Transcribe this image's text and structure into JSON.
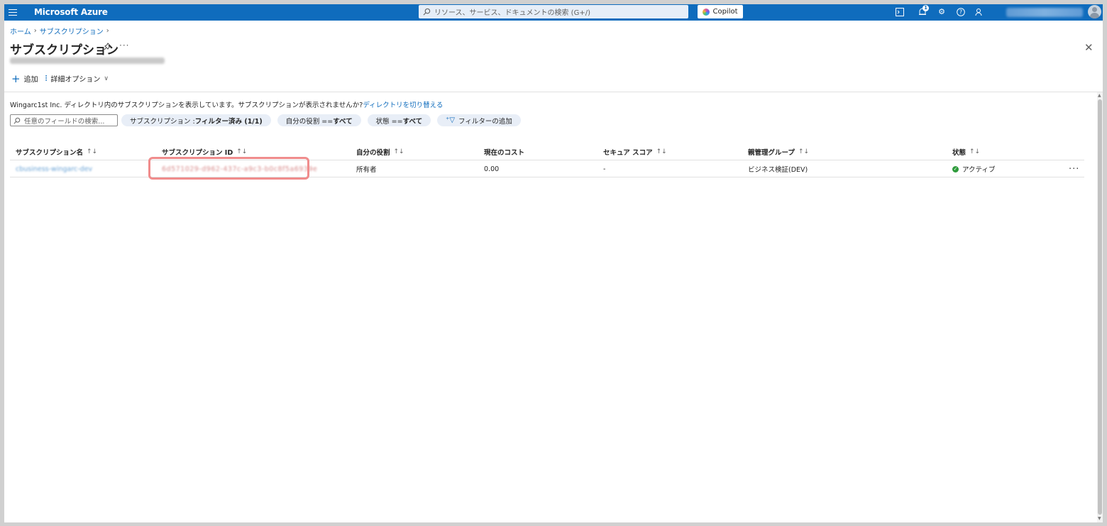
{
  "topbar": {
    "brand": "Microsoft Azure",
    "search_placeholder": "リソース、サービス、ドキュメントの検索 (G+/)",
    "copilot_label": "Copilot",
    "notification_count": "1"
  },
  "breadcrumb": {
    "home": "ホーム",
    "current": "サブスクリプション"
  },
  "header": {
    "title": "サブスクリプション"
  },
  "commandbar": {
    "add_label": "追加",
    "advanced_label": "詳細オプション"
  },
  "info": {
    "text": "Wingarc1st Inc. ディレクトリ内のサブスクリプションを表示しています。サブスクリプションが表示されませんか?",
    "link": "ディレクトリを切り替える"
  },
  "filters": {
    "search_placeholder": "任意のフィールドの検索...",
    "pills": [
      {
        "prefix": "サブスクリプション : ",
        "value": "フィルター済み (1/1)"
      },
      {
        "prefix": "自分の役割 == ",
        "value": "すべて"
      },
      {
        "prefix": "状態 == ",
        "value": "すべて"
      }
    ],
    "add_filter_label": "フィルターの追加"
  },
  "table": {
    "columns": [
      "サブスクリプション名",
      "サブスクリプション ID",
      "自分の役割",
      "現在のコスト",
      "セキュア スコア",
      "親管理グループ",
      "状態"
    ],
    "rows": [
      {
        "name": "cbusiness-wingarc-dev",
        "id": "6d571029-d962-437c-a9c3-b0c8f5a6939e",
        "role": "所有者",
        "cost": "0.00",
        "secure_score": "-",
        "parent_group": "ビジネス検証(DEV)",
        "status": "アクティブ"
      }
    ]
  },
  "colors": {
    "accent": "#0f6cbd",
    "highlight_border": "#f08c8c",
    "status_ok": "#2e9b3b"
  }
}
